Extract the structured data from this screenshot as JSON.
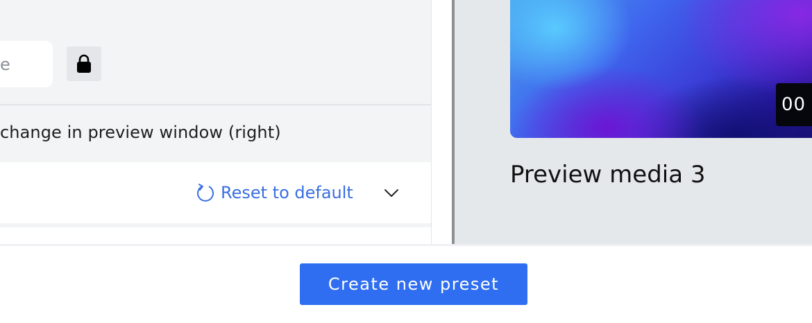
{
  "settings": {
    "size_input_value": "e",
    "lock_icon": "lock-icon",
    "hint_text": "change in preview window (right)",
    "reset_label": "Reset to default",
    "reset_icon": "reset-icon",
    "expand_icon": "chevron-down-icon"
  },
  "preview": {
    "title": "Preview media 3",
    "duration": "00"
  },
  "footer": {
    "create_label": "Create new preset"
  },
  "colors": {
    "accent": "#2f6ef0",
    "link": "#3a6fe0",
    "panel_bg": "#f3f4f6",
    "preview_bg": "#e5e8eb"
  }
}
